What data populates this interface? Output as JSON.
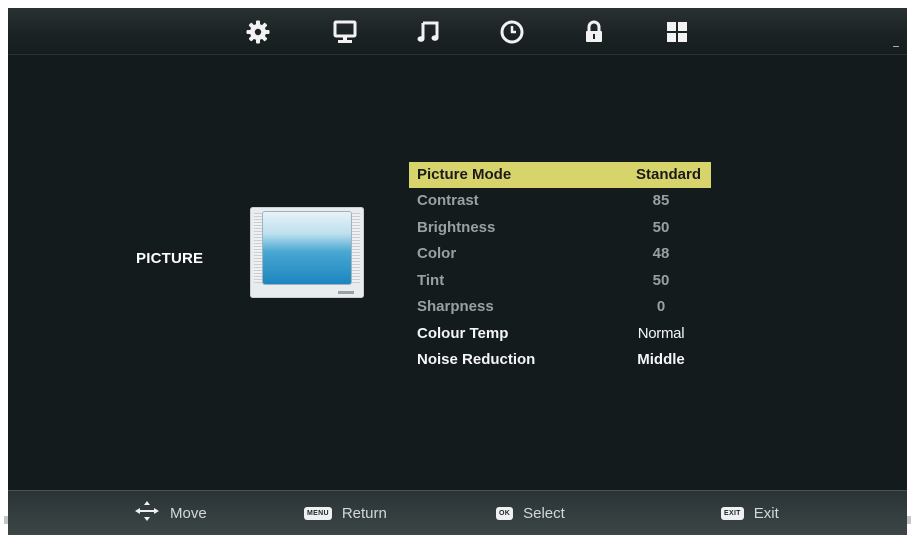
{
  "topbar": {
    "icons": [
      "gear-icon",
      "monitor-icon",
      "music-note-icon",
      "clock-icon",
      "lock-icon",
      "grid-icon"
    ]
  },
  "section": {
    "label": "PICTURE"
  },
  "menu": {
    "items": [
      {
        "label": "Picture Mode",
        "value": "Standard"
      },
      {
        "label": "Contrast",
        "value": "85"
      },
      {
        "label": "Brightness",
        "value": "50"
      },
      {
        "label": "Color",
        "value": "48"
      },
      {
        "label": "Tint",
        "value": "50"
      },
      {
        "label": "Sharpness",
        "value": "0"
      },
      {
        "label": "Colour Temp",
        "value": "Normal"
      },
      {
        "label": "Noise Reduction",
        "value": "Middle"
      }
    ]
  },
  "bottombar": {
    "move": {
      "label": "Move"
    },
    "return": {
      "key": "MENU",
      "label": "Return"
    },
    "select": {
      "key": "OK",
      "label": "Select"
    },
    "exit": {
      "key": "EXIT",
      "label": "Exit"
    }
  },
  "colors": {
    "background": "#141b1c",
    "highlight": "#d8d46c",
    "dimmed_text": "#9aa0a2",
    "text": "#f3f5f6"
  }
}
